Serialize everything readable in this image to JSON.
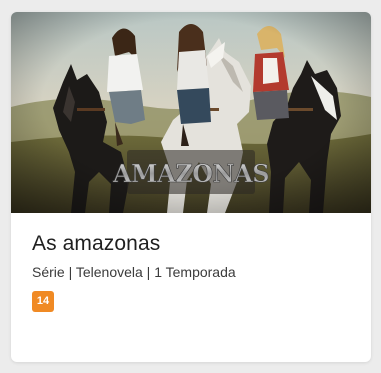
{
  "card": {
    "poster_logo": "AMAZONAS",
    "title": "As amazonas",
    "meta": "Série | Telenovela | 1 Temporada",
    "age_rating": "14",
    "age_rating_color": "#f08a24"
  }
}
